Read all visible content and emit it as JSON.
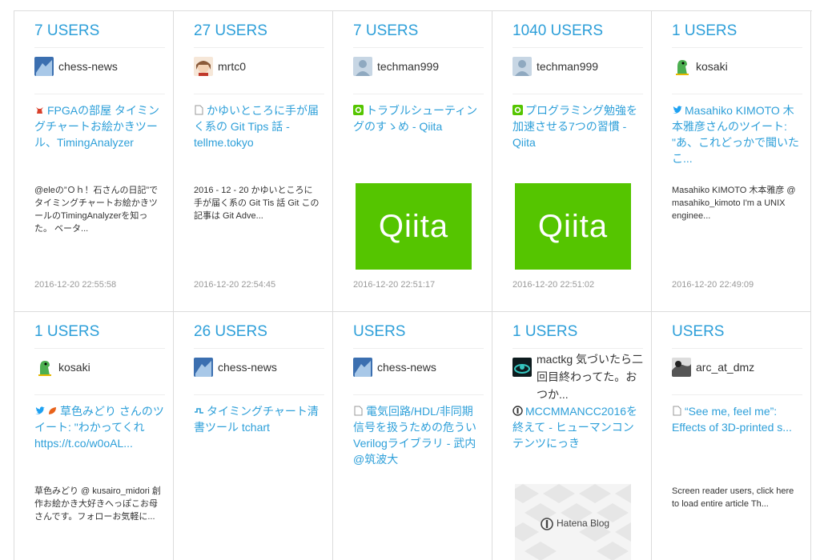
{
  "cards": [
    {
      "users": "7 USERS",
      "user": "chess-news",
      "title": "FPGAの部屋 タイミングチャートお絵かきツール、TimingAnalyzer",
      "description": "@eleの”Ｏｈ！石さんの日記”でタイミングチャートお絵かきツールのTimingAnalyzerを知った。 ベータ...",
      "date": "2016-12-20 22:55:58"
    },
    {
      "users": "27 USERS",
      "user": "mrtc0",
      "title": "かゆいところに手が届く系の Git Tips 話 - tellme.tokyo",
      "description": "2016 - 12 - 20 かゆいところに手が届く系の Git Tis 話 Git この記事は Git Adve...",
      "date": "2016-12-20 22:54:45"
    },
    {
      "users": "7 USERS",
      "user": "techman999",
      "title": "トラブルシューティングのすゝめ - Qiita",
      "thumb_text": "Qiita",
      "date": "2016-12-20 22:51:17"
    },
    {
      "users": "1040 USERS",
      "user": "techman999",
      "title": "プログラミング勉強を加速させる7つの習慣 - Qiita",
      "thumb_text": "Qiita",
      "date": "2016-12-20 22:51:02"
    },
    {
      "users": "1 USERS",
      "user": "kosaki",
      "title": "Masahiko KIMOTO 木本雅彦さんのツイート: \"あ、これどっかで聞いたこ...",
      "description": "Masahiko KIMOTO 木本雅彦 @ masahiko_kimoto I'm a UNIX enginee...",
      "date": "2016-12-20 22:49:09"
    },
    {
      "users": "1 USERS",
      "user": "kosaki",
      "title": "草色みどり さんのツイート: \"わかってくれ https://t.co/w0oAL...",
      "description": "草色みどり @ kusairo_midori 創作お絵かき大好きへっぽこお母さんです。フォローお気軽に..."
    },
    {
      "users": "26 USERS",
      "user": "chess-news",
      "title": "タイミングチャート清書ツール tchart"
    },
    {
      "users": "USERS",
      "user": "chess-news",
      "title": "電気回路/HDL/非同期信号を扱うための危ういVerilogライブラリ - 武内@筑波大"
    },
    {
      "users": "1 USERS",
      "user": "mactkg 気づいたら二回目終わってた。おつか...",
      "title": "MCCMMANCC2016を終えて - ヒューマンコンテンツにっき",
      "thumb_text": "Hatena Blog"
    },
    {
      "users": "USERS",
      "user": "arc_at_dmz",
      "title": "“See me, feel me”: Effects of 3D-printed s...",
      "description": "Screen reader users, click here to load entire article Th..."
    }
  ],
  "colors": {
    "accent": "#2d9fd9",
    "qiita": "#55c500",
    "border": "#dcdcdc",
    "date": "#999999"
  }
}
